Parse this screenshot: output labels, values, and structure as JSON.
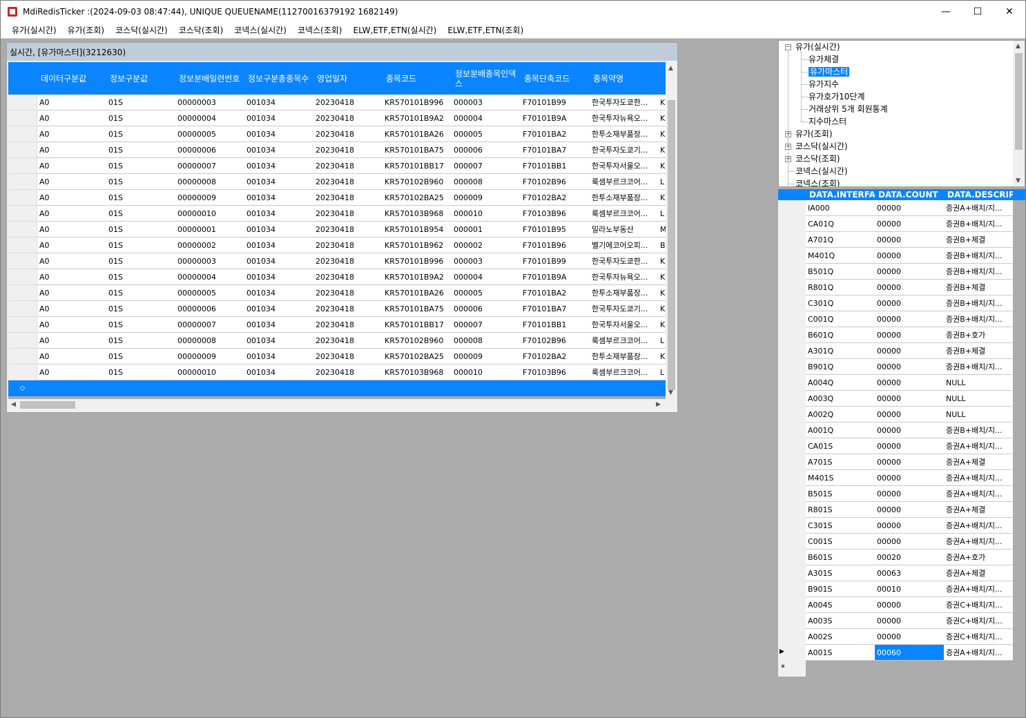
{
  "window": {
    "title": "MdiRedisTicker :(2024-09-03 08:47:44), UNIQUE QUEUENAME(11270016379192 1682149)",
    "minimize": "—",
    "maximize": "☐",
    "close": "✕"
  },
  "menu": [
    "유가(실시간)",
    "유가(조회)",
    "코스닥(실시간)",
    "코스닥(조회)",
    "코넥스(실시간)",
    "코넥스(조회)",
    "ELW,ETF,ETN(실시간)",
    "ELW,ETF,ETN(조회)"
  ],
  "child": {
    "title": "실시간, [유가마스터](3212630)",
    "columns": [
      "데이터구분값",
      "정보구분값",
      "정보분배일련번호",
      "정보구분총종목수",
      "영업일자",
      "종목코드",
      "정보분배종목인덱스",
      "종목단축코드",
      "종목약명"
    ],
    "rows": [
      [
        "A0",
        "01S",
        "00000003",
        "001034",
        "20230418",
        "KR570101B996",
        "000003",
        "F70101B99",
        "한국투자도쿄한...",
        "K"
      ],
      [
        "A0",
        "01S",
        "00000004",
        "001034",
        "20230418",
        "KR570101B9A2",
        "000004",
        "F70101B9A",
        "한국투자뉴욕오...",
        "K"
      ],
      [
        "A0",
        "01S",
        "00000005",
        "001034",
        "20230418",
        "KR570101BA26",
        "000005",
        "F70101BA2",
        "한투소재부품장...",
        "K"
      ],
      [
        "A0",
        "01S",
        "00000006",
        "001034",
        "20230418",
        "KR570101BA75",
        "000006",
        "F70101BA7",
        "한국투자도쿄기...",
        "K"
      ],
      [
        "A0",
        "01S",
        "00000007",
        "001034",
        "20230418",
        "KR570101BB17",
        "000007",
        "F70101BB1",
        "한국투자서울오...",
        "K"
      ],
      [
        "A0",
        "01S",
        "00000008",
        "001034",
        "20230418",
        "KR570102B960",
        "000008",
        "F70102B96",
        "룩셈부르크코어...",
        "L"
      ],
      [
        "A0",
        "01S",
        "00000009",
        "001034",
        "20230418",
        "KR570102BA25",
        "000009",
        "F70102BA2",
        "한투소재부품장...",
        "K"
      ],
      [
        "A0",
        "01S",
        "00000010",
        "001034",
        "20230418",
        "KR570103B968",
        "000010",
        "F70103B96",
        "룩셈부르크코어...",
        "L"
      ],
      [
        "A0",
        "01S",
        "00000001",
        "001034",
        "20230418",
        "KR570101B954",
        "000001",
        "F70101B95",
        "밀라노부동산",
        "M"
      ],
      [
        "A0",
        "01S",
        "00000002",
        "001034",
        "20230418",
        "KR570101B962",
        "000002",
        "F70101B96",
        "벨기에코어오피...",
        "B"
      ],
      [
        "A0",
        "01S",
        "00000003",
        "001034",
        "20230418",
        "KR570101B996",
        "000003",
        "F70101B99",
        "한국투자도쿄한...",
        "K"
      ],
      [
        "A0",
        "01S",
        "00000004",
        "001034",
        "20230418",
        "KR570101B9A2",
        "000004",
        "F70101B9A",
        "한국투자뉴욕오...",
        "K"
      ],
      [
        "A0",
        "01S",
        "00000005",
        "001034",
        "20230418",
        "KR570101BA26",
        "000005",
        "F70101BA2",
        "한투소재부품장...",
        "K"
      ],
      [
        "A0",
        "01S",
        "00000006",
        "001034",
        "20230418",
        "KR570101BA75",
        "000006",
        "F70101BA7",
        "한국투자도쿄기...",
        "K"
      ],
      [
        "A0",
        "01S",
        "00000007",
        "001034",
        "20230418",
        "KR570101BB17",
        "000007",
        "F70101BB1",
        "한국투자서울오...",
        "K"
      ],
      [
        "A0",
        "01S",
        "00000008",
        "001034",
        "20230418",
        "KR570102B960",
        "000008",
        "F70102B96",
        "룩셈부르크코어...",
        "L"
      ],
      [
        "A0",
        "01S",
        "00000009",
        "001034",
        "20230418",
        "KR570102BA25",
        "000009",
        "F70102BA2",
        "한투소재부품장...",
        "K"
      ],
      [
        "A0",
        "01S",
        "00000010",
        "001034",
        "20230418",
        "KR570103B968",
        "000010",
        "F70103B96",
        "룩셈부르크코어...",
        "L"
      ]
    ]
  },
  "tree": {
    "nodes": [
      {
        "label": "유가(실시간)",
        "level": 0,
        "expanded": true
      },
      {
        "label": "유가체결",
        "level": 1
      },
      {
        "label": "유가마스터",
        "level": 1,
        "selected": true
      },
      {
        "label": "유가지수",
        "level": 1
      },
      {
        "label": "유가호가10단계",
        "level": 1
      },
      {
        "label": "거래상위 5개 회원통계",
        "level": 1
      },
      {
        "label": "지수마스터",
        "level": 1
      },
      {
        "label": "유가(조회)",
        "level": 0,
        "expanded": false
      },
      {
        "label": "코스닥(실시간)",
        "level": 0,
        "expanded": false
      },
      {
        "label": "코스닥(조회)",
        "level": 0,
        "expanded": false
      },
      {
        "label": "코넥스(실시간)",
        "level": 0
      },
      {
        "label": "코넥스(조회)",
        "level": 0
      }
    ]
  },
  "right_grid": {
    "columns": [
      "DATA.INTERFACE",
      "DATA.COUNT",
      "DATA.DESCRIPTI"
    ],
    "rows": [
      [
        "IA000",
        "00000",
        "증권A+배치/지..."
      ],
      [
        "CA01Q",
        "00000",
        "증권B+배치/지..."
      ],
      [
        "A701Q",
        "00000",
        "증권B+체결"
      ],
      [
        "M401Q",
        "00000",
        "증권B+배치/지..."
      ],
      [
        "B501Q",
        "00000",
        "증권B+배치/지..."
      ],
      [
        "R801Q",
        "00000",
        "증권B+체결"
      ],
      [
        "C301Q",
        "00000",
        "증권B+배치/지..."
      ],
      [
        "C001Q",
        "00000",
        "증권B+배치/지..."
      ],
      [
        "B601Q",
        "00000",
        "증권B+호가"
      ],
      [
        "A301Q",
        "00000",
        "증권B+체결"
      ],
      [
        "B901Q",
        "00000",
        "증권B+배치/지..."
      ],
      [
        "A004Q",
        "00000",
        "NULL"
      ],
      [
        "A003Q",
        "00000",
        "NULL"
      ],
      [
        "A002Q",
        "00000",
        "NULL"
      ],
      [
        "A001Q",
        "00000",
        "증권B+배치/지..."
      ],
      [
        "CA01S",
        "00000",
        "증권A+배치/지..."
      ],
      [
        "A701S",
        "00000",
        "증권A+체결"
      ],
      [
        "M401S",
        "00000",
        "증권A+배치/지..."
      ],
      [
        "B501S",
        "00000",
        "증권A+배치/지..."
      ],
      [
        "R801S",
        "00000",
        "증권A+체결"
      ],
      [
        "C301S",
        "00000",
        "증권A+배치/지..."
      ],
      [
        "C001S",
        "00000",
        "증권A+배치/지..."
      ],
      [
        "B601S",
        "00020",
        "증권A+호가"
      ],
      [
        "A301S",
        "00063",
        "증권A+체결"
      ],
      [
        "B901S",
        "00010",
        "증권A+배치/지..."
      ],
      [
        "A004S",
        "00000",
        "증권C+배치/지..."
      ],
      [
        "A003S",
        "00000",
        "증권C+배치/지..."
      ],
      [
        "A002S",
        "00000",
        "증권C+배치/지..."
      ],
      [
        "A001S",
        "00060",
        "증권A+배치/지..."
      ]
    ],
    "current_row_marker": "▶",
    "new_row_marker": "*"
  }
}
